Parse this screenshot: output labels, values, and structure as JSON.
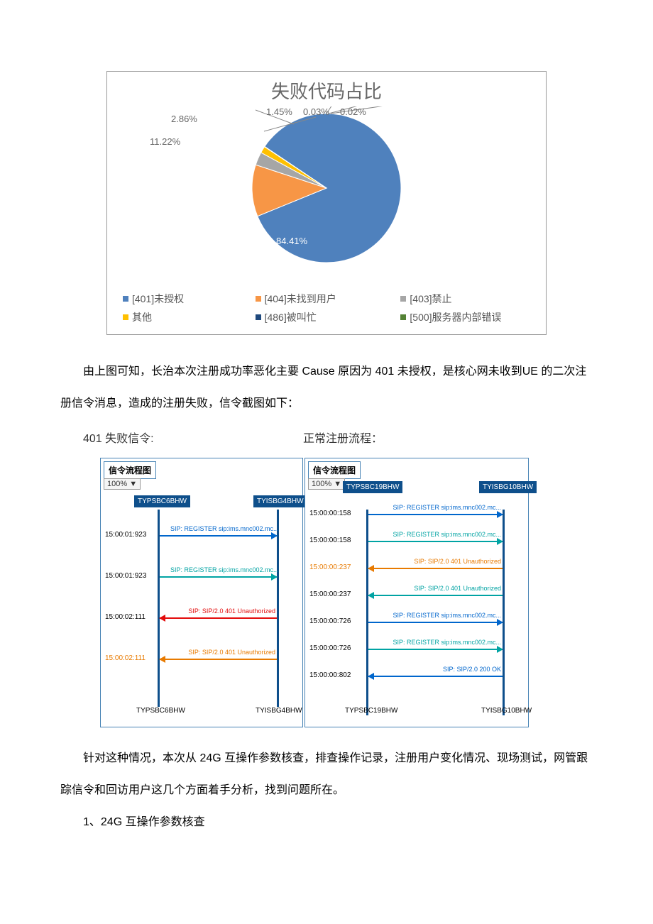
{
  "chart_data": {
    "type": "pie",
    "title": "失败代码占比",
    "series": [
      {
        "name": "[401]未授权",
        "value": 84.41,
        "label": "84.41%",
        "color": "#4f81bd"
      },
      {
        "name": "[404]未找到用户",
        "value": 11.22,
        "label": "11.22%",
        "color": "#f79646"
      },
      {
        "name": "[403]禁止",
        "value": 2.86,
        "label": "2.86%",
        "color": "#a6a6a6"
      },
      {
        "name": "其他",
        "value": 1.45,
        "label": "1.45%",
        "color": "#ffc000"
      },
      {
        "name": "[486]被叫忙",
        "value": 0.03,
        "label": "0.03%",
        "color": "#1f497d"
      },
      {
        "name": "[500]服务器内部错误",
        "value": 0.02,
        "label": "0.02%",
        "color": "#548235"
      }
    ]
  },
  "paragraph1": "由上图可知，长治本次注册成功率恶化主要 Cause 原因为 401 未授权，是核心网未收到UE 的二次注册信令消息，造成的注册失败，信令截图如下：",
  "labels": {
    "left": "401 失败信令:",
    "right": "正常注册流程："
  },
  "diagram_common": {
    "panel_title": "信令流程图",
    "zoom": "100% ▼"
  },
  "diagram_a": {
    "nodes": {
      "left": "TYPSBC6BHW",
      "right": "TYISBG4BHW",
      "left_btm": "TYPSBC6BHW",
      "right_btm": "TYISBG4BHW"
    },
    "messages": [
      {
        "t": "15:00:01:923",
        "txt": "SIP: REGISTER sip:ims.mnc002.mc...",
        "color": "#0066cc",
        "dir": "right",
        "time_color": "#000"
      },
      {
        "t": "15:00:01:923",
        "txt": "SIP: REGISTER sip:ims.mnc002.mc...",
        "color": "#00a3a3",
        "dir": "right",
        "time_color": "#000"
      },
      {
        "t": "15:00:02:111",
        "txt": "SIP: SIP/2.0 401 Unauthorized",
        "color": "#e30b0b",
        "dir": "left",
        "time_color": "#000"
      },
      {
        "t": "15:00:02:111",
        "txt": "SIP: SIP/2.0 401 Unauthorized",
        "color": "#e87a00",
        "dir": "left",
        "time_color": "#e87a00"
      }
    ]
  },
  "diagram_b": {
    "nodes": {
      "left": "TYPSBC19BHW",
      "right": "TYISBG10BHW",
      "left_btm": "TYPSBC19BHW",
      "right_btm": "TYISBG10BHW"
    },
    "messages": [
      {
        "t": "15:00:00:158",
        "txt": "SIP: REGISTER sip:ims.mnc002.mc...",
        "color": "#0066cc",
        "dir": "right",
        "time_color": "#000"
      },
      {
        "t": "15:00:00:158",
        "txt": "SIP: REGISTER sip:ims.mnc002.mc...",
        "color": "#00a3a3",
        "dir": "right",
        "time_color": "#000"
      },
      {
        "t": "15:00:00:237",
        "txt": "SIP: SIP/2.0 401 Unauthorized",
        "color": "#e87a00",
        "dir": "left",
        "time_color": "#e87a00"
      },
      {
        "t": "15:00:00:237",
        "txt": "SIP: SIP/2.0 401 Unauthorized",
        "color": "#00a3a3",
        "dir": "left",
        "time_color": "#000"
      },
      {
        "t": "15:00:00:726",
        "txt": "SIP: REGISTER sip:ims.mnc002.mc...",
        "color": "#0066cc",
        "dir": "right",
        "time_color": "#000"
      },
      {
        "t": "15:00:00:726",
        "txt": "SIP: REGISTER sip:ims.mnc002.mc...",
        "color": "#00a3a3",
        "dir": "right",
        "time_color": "#000"
      },
      {
        "t": "15:00:00:802",
        "txt": "SIP: SIP/2.0 200 OK",
        "color": "#0066cc",
        "dir": "left",
        "time_color": "#000"
      }
    ]
  },
  "paragraph2": "针对这种情况，本次从 24G 互操作参数核查，排查操作记录，注册用户变化情况、现场测试，网管跟踪信令和回访用户这几个方面着手分析，找到问题所在。",
  "paragraph3": "1、24G 互操作参数核查"
}
